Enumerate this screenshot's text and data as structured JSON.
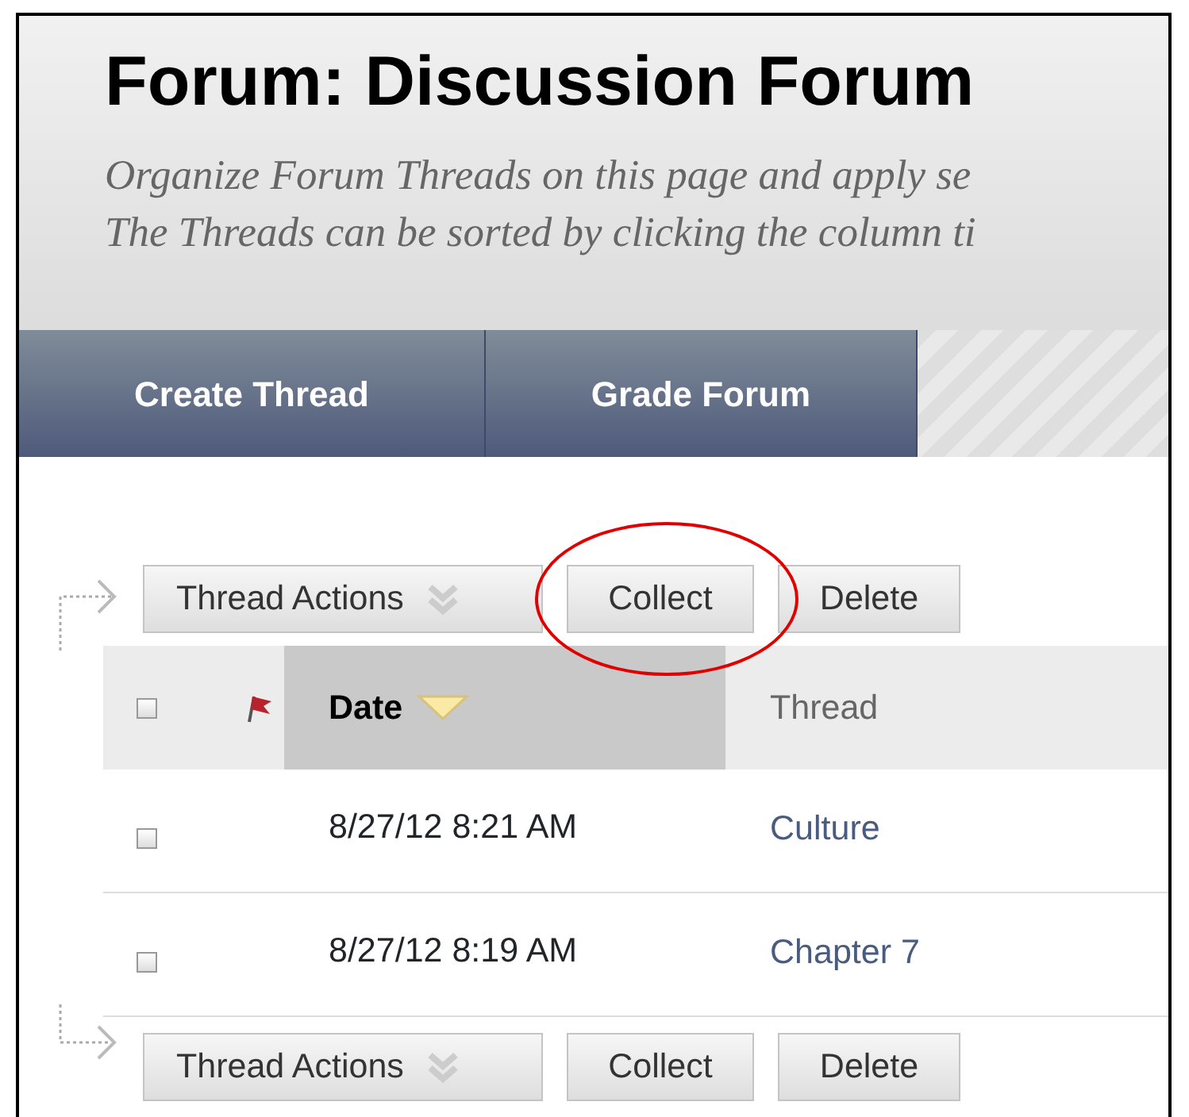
{
  "page_header": {
    "title": "Forum: Discussion Forum",
    "description": [
      "Organize Forum Threads on this page and apply se",
      "The Threads can be sorted by clicking the column ti"
    ]
  },
  "nav_buttons": [
    {
      "label": "Create Thread"
    },
    {
      "label": "Grade Forum"
    }
  ],
  "action_bars": [
    {
      "kind": "top",
      "buttons": [
        {
          "label": "Thread Actions",
          "kind": "menu"
        },
        {
          "label": "Collect",
          "kind": "plain",
          "highlighted": true
        },
        {
          "label": "Delete",
          "kind": "plain"
        }
      ]
    },
    {
      "kind": "bottom",
      "buttons": [
        {
          "label": "Thread Actions",
          "kind": "menu"
        },
        {
          "label": "Collect",
          "kind": "plain"
        },
        {
          "label": "Delete",
          "kind": "plain"
        }
      ]
    }
  ],
  "table": {
    "select_all_checked": false,
    "columns": [
      {
        "label": "Date",
        "sorted": true
      },
      {
        "label": "Thread",
        "sorted": false
      }
    ],
    "rows": [
      {
        "checked": false,
        "date": "8/27/12 8:21 AM",
        "thread": "Culture"
      },
      {
        "checked": false,
        "date": "8/27/12 8:19 AM",
        "thread": "Chapter 7"
      }
    ]
  }
}
